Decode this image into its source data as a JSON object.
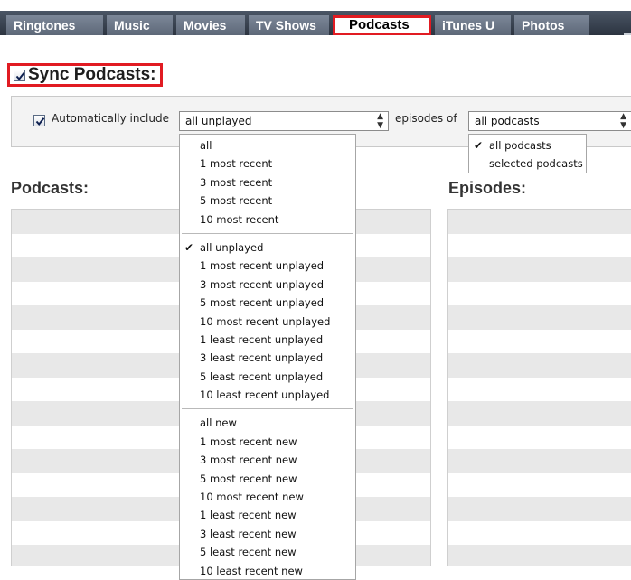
{
  "tabs": [
    {
      "label": "Ringtones",
      "active": false
    },
    {
      "label": "Music",
      "active": false
    },
    {
      "label": "Movies",
      "active": false
    },
    {
      "label": "TV Shows",
      "active": false
    },
    {
      "label": "Podcasts",
      "active": true
    },
    {
      "label": "iTunes U",
      "active": false
    },
    {
      "label": "Photos",
      "active": false
    }
  ],
  "sync": {
    "label": "Sync Podcasts:",
    "checked": true
  },
  "options": {
    "auto_include_label": "Automatically include",
    "auto_include_checked": true,
    "include_selected": "all unplayed",
    "episodes_of_label": "episodes of",
    "podcasts_selected": "all podcasts"
  },
  "include_menu": {
    "groups": [
      [
        "all",
        "1 most recent",
        "3 most recent",
        "5 most recent",
        "10 most recent"
      ],
      [
        "all unplayed",
        "1 most recent unplayed",
        "3 most recent unplayed",
        "5 most recent unplayed",
        "10 most recent unplayed",
        "1 least recent unplayed",
        "3 least recent unplayed",
        "5 least recent unplayed",
        "10 least recent unplayed"
      ],
      [
        "all new",
        "1 most recent new",
        "3 most recent new",
        "5 most recent new",
        "10 most recent new",
        "1 least recent new",
        "3 least recent new",
        "5 least recent new",
        "10 least recent new"
      ]
    ],
    "selected": "all unplayed"
  },
  "podcasts_menu": {
    "items": [
      "all podcasts",
      "selected podcasts"
    ],
    "selected": "all podcasts"
  },
  "podcasts_title": "Podcasts:",
  "episodes_title": "Episodes:",
  "colors": {
    "highlight": "#e11b22",
    "tab_bar": "#3a4452",
    "stripe": "#e8e8e8"
  }
}
